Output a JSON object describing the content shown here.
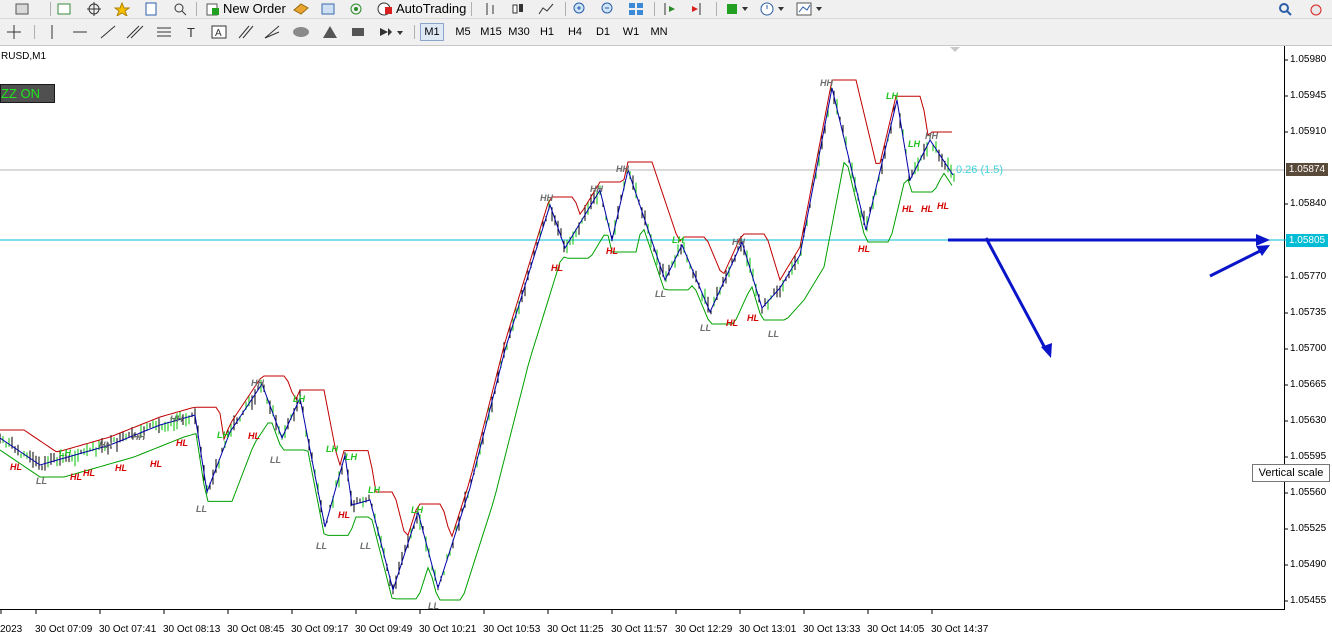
{
  "toolbar": {
    "new_order_label": "New Order",
    "auto_trading_label": "AutoTrading"
  },
  "timeframes": [
    "M1",
    "M5",
    "M15",
    "M30",
    "H1",
    "H4",
    "D1",
    "W1",
    "MN"
  ],
  "active_timeframe": "M1",
  "chart": {
    "symbol_title": "RUSD,M1",
    "indicator_button": "ZZ ON",
    "spread_text": "0.26 (1.5)",
    "tooltip": "Vertical scale",
    "bid_tag": "1.05874",
    "hline_tag": "1.05805",
    "price_ticks": [
      "1.05980",
      "1.05945",
      "1.05910",
      "1.05840",
      "1.05770",
      "1.05735",
      "1.05700",
      "1.05665",
      "1.05630",
      "1.05595",
      "1.05560",
      "1.05525",
      "1.05490",
      "1.05455"
    ],
    "time_ticks": [
      "2023",
      "30 Oct 07:09",
      "30 Oct 07:41",
      "30 Oct 08:13",
      "30 Oct 08:45",
      "30 Oct 09:17",
      "30 Oct 09:49",
      "30 Oct 10:21",
      "30 Oct 10:53",
      "30 Oct 11:25",
      "30 Oct 11:57",
      "30 Oct 12:29",
      "30 Oct 13:01",
      "30 Oct 13:33",
      "30 Oct 14:05",
      "30 Oct 14:37"
    ],
    "colors": {
      "upper_band": "#c00000",
      "lower_band": "#00a000",
      "zigzag": "#0000aa",
      "hline": "#00bcd4",
      "arrow": "#0a14c8"
    },
    "swing_labels": [
      {
        "t": "HH"
      },
      {
        "t": "HH"
      },
      {
        "t": "HH"
      },
      {
        "t": "HH"
      },
      {
        "t": "HH"
      },
      {
        "t": "HH"
      },
      {
        "t": "HH"
      },
      {
        "t": "HH"
      },
      {
        "t": "HH"
      },
      {
        "t": "HH"
      },
      {
        "t": "LL"
      },
      {
        "t": "LL"
      },
      {
        "t": "LL"
      },
      {
        "t": "LL"
      },
      {
        "t": "LL"
      },
      {
        "t": "LL"
      },
      {
        "t": "LL"
      },
      {
        "t": "LL"
      },
      {
        "t": "LL"
      },
      {
        "t": "HL"
      },
      {
        "t": "HL"
      },
      {
        "t": "HL"
      },
      {
        "t": "HL"
      },
      {
        "t": "HL"
      },
      {
        "t": "HL"
      },
      {
        "t": "HL"
      },
      {
        "t": "HL"
      },
      {
        "t": "HL"
      },
      {
        "t": "HL"
      },
      {
        "t": "HL"
      },
      {
        "t": "HL"
      },
      {
        "t": "HL"
      },
      {
        "t": "LH"
      },
      {
        "t": "LH"
      },
      {
        "t": "LH"
      },
      {
        "t": "LH"
      },
      {
        "t": "LH"
      },
      {
        "t": "LH"
      },
      {
        "t": "LH"
      },
      {
        "t": "LH"
      },
      {
        "t": "LH"
      },
      {
        "t": "LH"
      }
    ]
  }
}
